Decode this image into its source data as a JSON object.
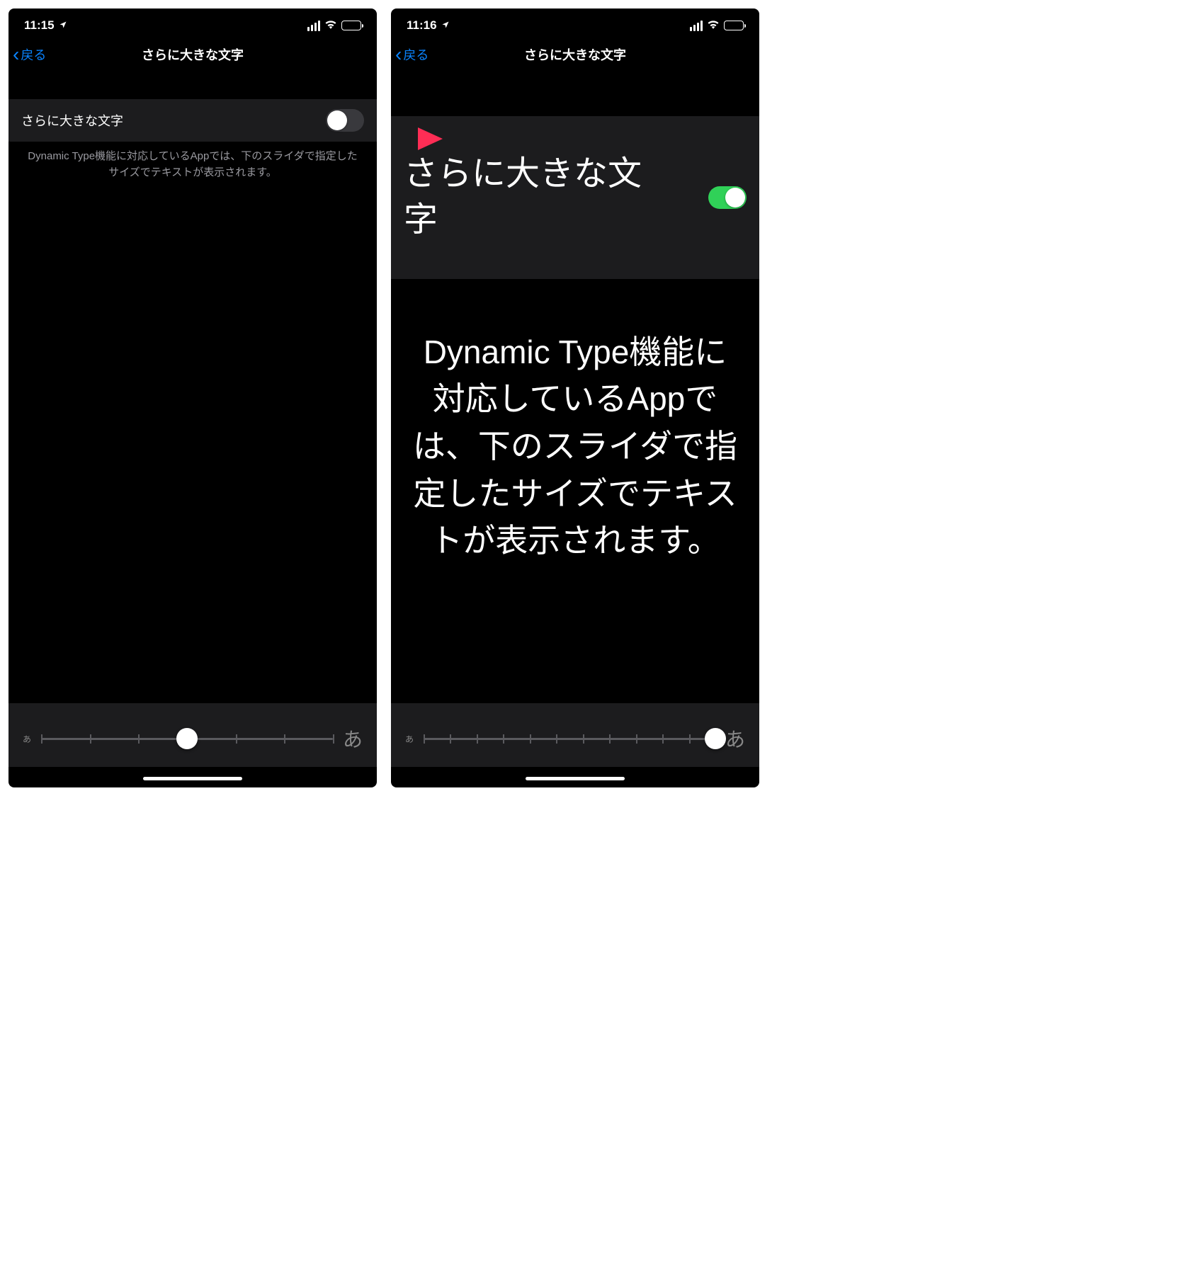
{
  "left": {
    "status": {
      "time": "11:15"
    },
    "nav": {
      "back": "戻る",
      "title": "さらに大きな文字"
    },
    "setting": {
      "label": "さらに大きな文字",
      "toggle_on": false
    },
    "description": "Dynamic Type機能に対応しているAppでは、下のスライダで指定したサイズでテキストが表示されます。",
    "slider": {
      "small_glyph": "あ",
      "large_glyph": "あ",
      "ticks": 7,
      "thumb_index": 3
    }
  },
  "right": {
    "status": {
      "time": "11:16"
    },
    "nav": {
      "back": "戻る",
      "title": "さらに大きな文字"
    },
    "setting": {
      "label": "さらに大きな文字",
      "toggle_on": true
    },
    "description": "Dynamic Type機能に対応しているAppでは、下のスライダで指定したサイズでテキストが表示されます。",
    "slider": {
      "small_glyph": "あ",
      "large_glyph": "あ",
      "ticks": 12,
      "thumb_index": 11
    }
  }
}
